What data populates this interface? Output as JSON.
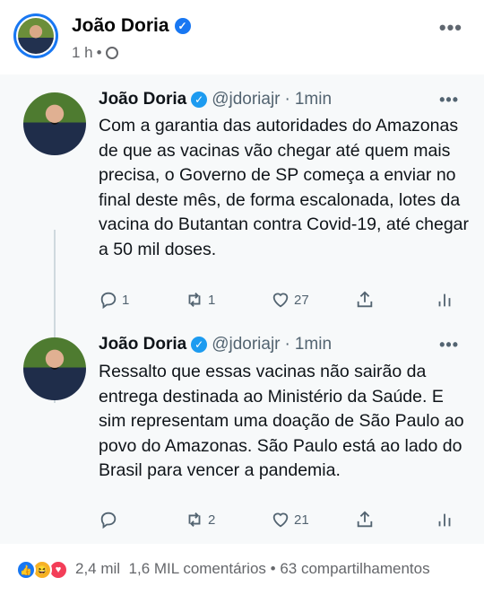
{
  "post": {
    "author": "João Doria",
    "time": "1 h",
    "separator": "•",
    "more": "•••"
  },
  "tweets": [
    {
      "name": "João Doria",
      "handle": "@jdoriajr",
      "time": "1min",
      "text": "Com a garantia das autoridades do Amazonas de que as vacinas vão chegar até quem mais precisa, o Governo de SP começa a enviar no final deste mês, de forma escalonada, lotes da vacina do Butantan contra Covid-19, até chegar a 50 mil doses.",
      "replies": "1",
      "retweets": "1",
      "likes": "27"
    },
    {
      "name": "João Doria",
      "handle": "@jdoriajr",
      "time": "1min",
      "text": "Ressalto que essas vacinas não sairão da entrega destinada ao Ministério da Saúde. E sim representam uma doação de São Paulo ao povo do Amazonas. São Paulo está ao lado do Brasil para vencer a pandemia.",
      "replies": "",
      "retweets": "2",
      "likes": "21"
    }
  ],
  "tweet_dot": "·",
  "footer": {
    "reactions_count": "2,4 mil",
    "comments": "1,6 MIL comentários",
    "dot": "•",
    "shares": "63 compartilhamentos"
  },
  "icons": [
    "verified-icon",
    "globe-icon",
    "reply-icon",
    "retweet-icon",
    "like-icon",
    "share-icon",
    "analytics-icon",
    "more-icon"
  ],
  "colors": {
    "facebook_blue": "#1877f2",
    "twitter_blue": "#1d9bf0",
    "love_red": "#f33e58",
    "haha_yellow": "#f7b125"
  }
}
